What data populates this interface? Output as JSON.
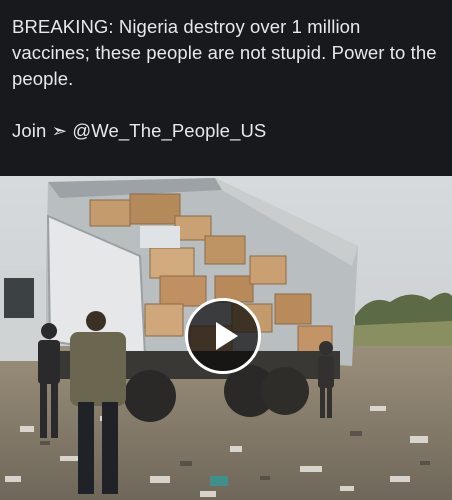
{
  "post": {
    "text": "BREAKING: Nigeria destroy over 1 million vaccines; these people are not stupid. Power to the people.",
    "join": "Join ➣ @We_The_People_US"
  },
  "media": {
    "type": "video",
    "play_icon": "play-icon"
  },
  "colors": {
    "background": "#17191d",
    "text": "#e8e8e8",
    "play_overlay": "#0a0a0a"
  }
}
